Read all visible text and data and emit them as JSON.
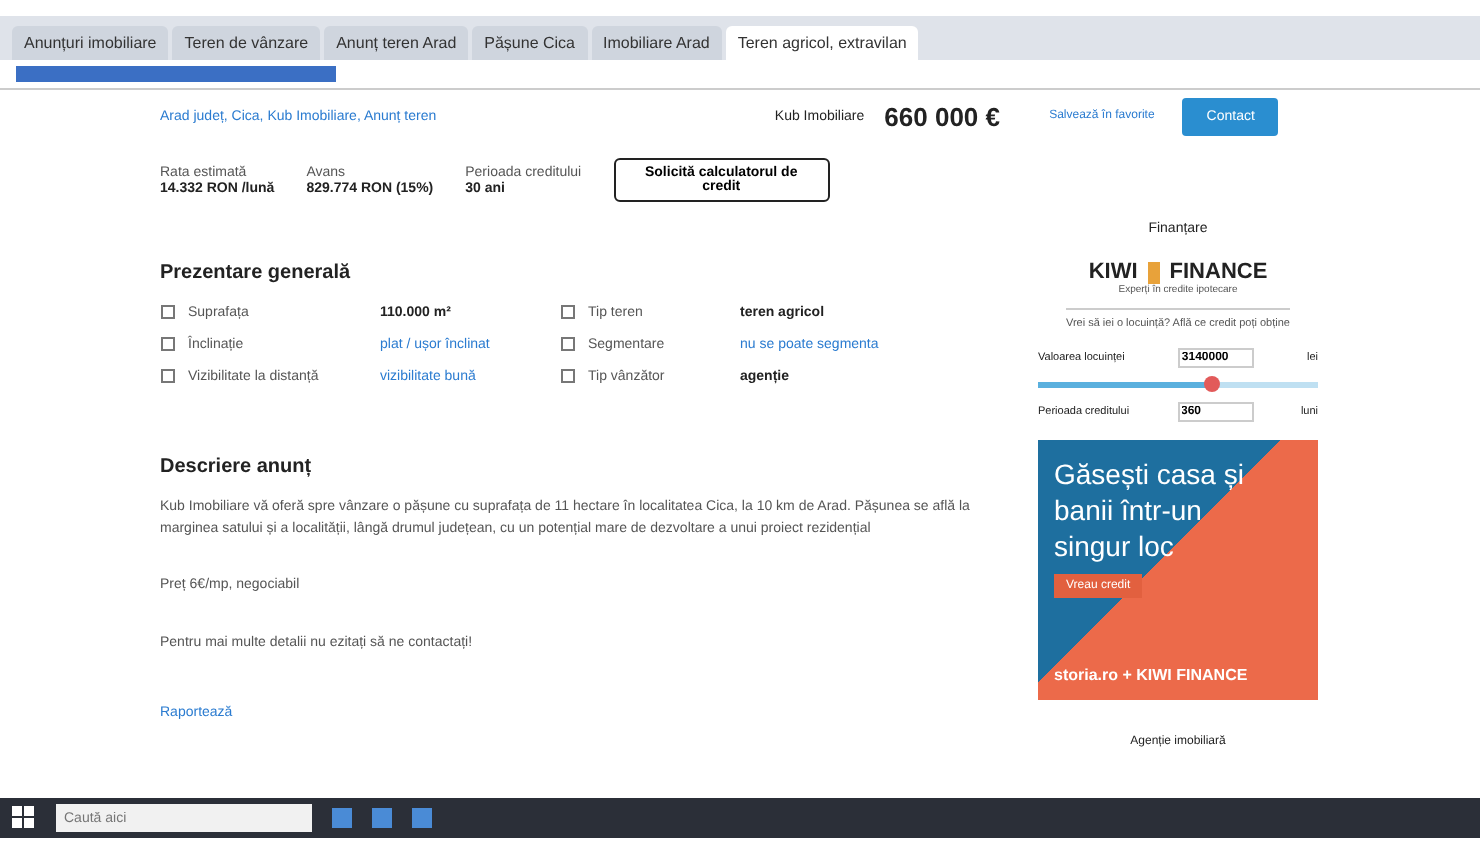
{
  "browser": {
    "tabs": [
      {
        "title": "Anunțuri imobiliare",
        "selected": false
      },
      {
        "title": "Teren de vânzare",
        "selected": false
      },
      {
        "title": "Anunț teren Arad",
        "selected": false
      },
      {
        "title": "Pășune Cica",
        "selected": false
      },
      {
        "title": "Imobiliare Arad",
        "selected": false
      },
      {
        "title": "Teren agricol, extravilan",
        "selected": true
      }
    ]
  },
  "header": {
    "location": "Arad județ, Cica, Kub Imobiliare, Anunț teren",
    "seller": "Kub Imobiliare",
    "price": "660 000 €",
    "save_button": "Salvează în favorite",
    "contact_button": "Contact"
  },
  "credit": [
    {
      "label": "Rata estimată",
      "value": "14.332 RON /lună"
    },
    {
      "label": "Avans",
      "value": "829.774 RON (15%)"
    },
    {
      "label": "Perioada creditului",
      "value": "30 ani"
    }
  ],
  "credit_button": "Solicită calculatorul de credit",
  "overview": {
    "title": "Prezentare generală",
    "items": [
      {
        "label": "Suprafața",
        "value": "110.000 m²",
        "kind": "text"
      },
      {
        "label": "Tip teren",
        "value": "teren agricol",
        "kind": "text"
      },
      {
        "label": "Înclinație",
        "value": "plat / ușor înclinat",
        "kind": "link"
      },
      {
        "label": "Segmentare",
        "value": "nu se poate segmenta",
        "kind": "link"
      },
      {
        "label": "Vizibilitate la distanță",
        "value": "vizibilitate bună",
        "kind": "link"
      },
      {
        "label": "Tip vânzător",
        "value": "agenție",
        "kind": "text"
      }
    ]
  },
  "description": {
    "title": "Descriere anunț",
    "paragraphs": [
      "Kub Imobiliare vă oferă spre vânzare o pășune cu suprafața de 11 hectare în localitatea Cica, la 10 km de Arad. Pășunea se află la marginea satului și a localității, lângă drumul județean, cu un potențial mare de dezvoltare a unui proiect rezidențial",
      "Preț 6€/mp, negociabil",
      "Pentru mai multe detalii nu ezitați să ne contactați!"
    ],
    "link": "Raportează"
  },
  "sidebar": {
    "title": "Finanțare",
    "logo_left": "KIWI",
    "logo_right": "FINANCE",
    "tagline": "Experți în credite ipotecare",
    "question": "Vrei să iei o locuință? Află ce credit poți obține",
    "value_label": "Valoarea locuinței",
    "value": "3140000",
    "value_unit": "lei",
    "slider": {
      "level": 0.62
    },
    "period_label": "Perioada creditului",
    "period": "360",
    "period_unit": "luni",
    "banner": {
      "headline": "Găsești casa și banii într-un singur loc",
      "button": "Vreau credit",
      "footer": "storia.ro + KIWI FINANCE"
    },
    "agency": "Agenție imobiliară"
  },
  "taskbar": {
    "search_placeholder": "Caută aici"
  }
}
